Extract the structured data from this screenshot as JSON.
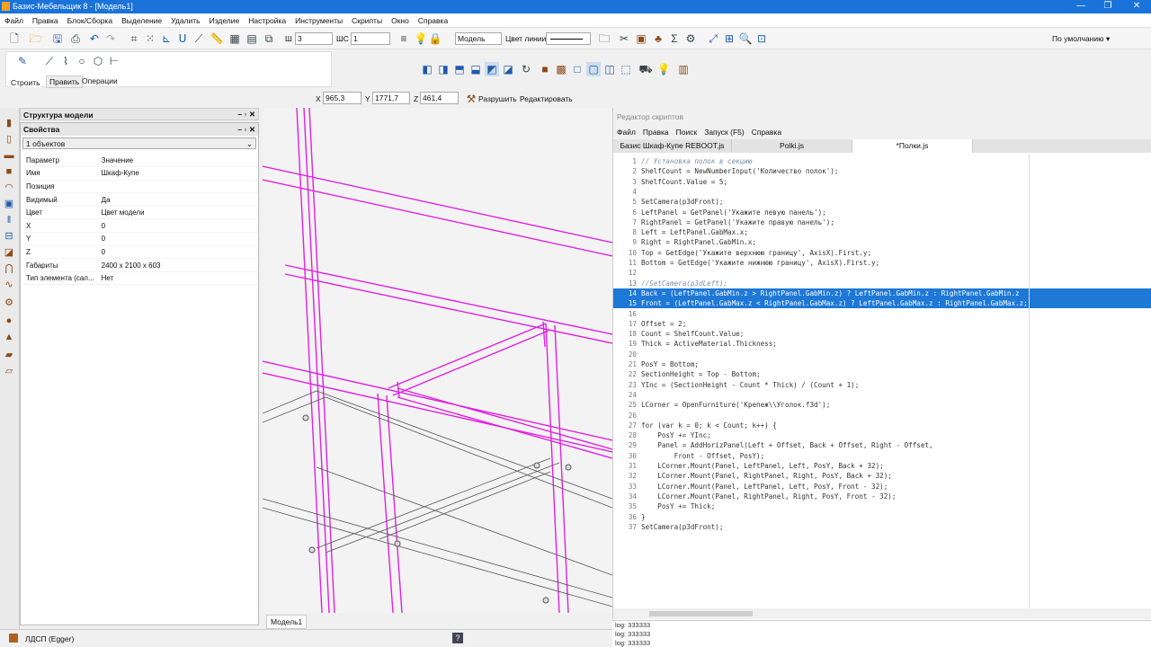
{
  "titlebar": {
    "title": "Базис-Мебельщик 8 - [Модель1]"
  },
  "menu": [
    "Файл",
    "Правка",
    "Блок/Сборка",
    "Выделение",
    "Удалить",
    "Изделие",
    "Настройка",
    "Инструменты",
    "Скрипты",
    "Окно",
    "Справка"
  ],
  "toolbar": {
    "w_label": "Ш",
    "w_value": "3",
    "wc_label": "ШС",
    "wc_value": "1",
    "layer_value": "Модель",
    "line_color_label": "Цвет линии",
    "profile": "По умолчанию"
  },
  "draw_panel": {
    "tabs": [
      "Строить",
      "Править",
      "Операции"
    ]
  },
  "coords": {
    "x_label": "X",
    "x": "965,3",
    "y_label": "Y",
    "y": "1771,7",
    "z_label": "Z",
    "z": "461,4",
    "break_label": "Разрушить",
    "edit_label": "Редактировать"
  },
  "panels": {
    "structure_title": "Структура модели",
    "props_title": "Свойства",
    "selection": "1 объектов",
    "table_header": [
      "Параметр",
      "Значение"
    ],
    "rows": [
      [
        "Имя",
        "Шкаф-Купе"
      ],
      [
        "Позиция",
        ""
      ],
      [
        "Видимый",
        "Да"
      ],
      [
        "Цвет",
        "Цвет модели"
      ],
      [
        "X",
        "0"
      ],
      [
        "Y",
        "0"
      ],
      [
        "Z",
        "0"
      ],
      [
        "Габариты",
        "2400 x 2100 x 603"
      ],
      [
        "Тип элемента (сал...",
        "Нет"
      ]
    ]
  },
  "viewport": {
    "tab": "Модель1"
  },
  "editor": {
    "title": "Редактор скриптов",
    "menu": [
      "Файл",
      "Правка",
      "Поиск",
      "Запуск (F5)",
      "Справка"
    ],
    "tabs": [
      "Базис Шкаф-Купе REBOOT.js",
      "Polki.js",
      "*Полки.js"
    ],
    "lines": [
      "// Установка полок в секцию",
      "ShelfCount = NewNumberInput('Количество полок');",
      "ShelfCount.Value = 5;",
      "",
      "SetCamera(p3dFront);",
      "LeftPanel = GetPanel('Укажите левую панель');",
      "RightPanel = GetPanel('Укажите правую панель');",
      "Left = LeftPanel.GabMax.x;",
      "Right = RightPanel.GabMin.x;",
      "Top = GetEdge('Укажите верхнюю границу', AxisX).First.y;",
      "Bottom = GetEdge('Укажите нижнюю границу', AxisX).First.y;",
      "",
      "//SetCamera(p3dLeft);",
      "Back = (LeftPanel.GabMin.z > RightPanel.GabMin.z) ? LeftPanel.GabMin.z : RightPanel.GabMin.z",
      "Front = (LeftPanel.GabMax.z < RightPanel.GabMax.z) ? LeftPanel.GabMax.z : RightPanel.GabMax.z;",
      "",
      "Offset = 2;",
      "Count = ShelfCount.Value;",
      "Thick = ActiveMaterial.Thickness;",
      "",
      "PosY = Bottom;",
      "SectionHeight = Top - Bottom;",
      "YInc = (SectionHeight - Count * Thick) / (Count + 1);",
      "",
      "LCorner = OpenFurniture('Крепеж\\\\Уголок.f3d');",
      "",
      "for (var k = 0; k < Count; k++) {",
      "    PosY += YInc;",
      "    Panel = AddHorizPanel(Left + Offset, Back + Offset, Right - Offset,",
      "        Front - Offset, PosY);",
      "    LCorner.Mount(Panel, LeftPanel, Left, PosY, Back + 32);",
      "    LCorner.Mount(Panel, RightPanel, Right, PosY, Back + 32);",
      "    LCorner.Mount(Panel, LeftPanel, Left, PosY, Front - 32);",
      "    LCorner.Mount(Panel, RightPanel, Right, PosY, Front - 32);",
      "    PosY += Thick;",
      "}",
      "SetCamera(p3dFront);"
    ],
    "highlighted": [
      14,
      15
    ],
    "comments": [
      1,
      13
    ]
  },
  "log": [
    "log: 333333",
    "log: 333333",
    "log: 333333"
  ],
  "status": {
    "material": "ЛДСП (Egger)"
  },
  "colors": {
    "title": "#1a73d9",
    "selection": "#1e78d6",
    "magenta": "#e020e0"
  }
}
